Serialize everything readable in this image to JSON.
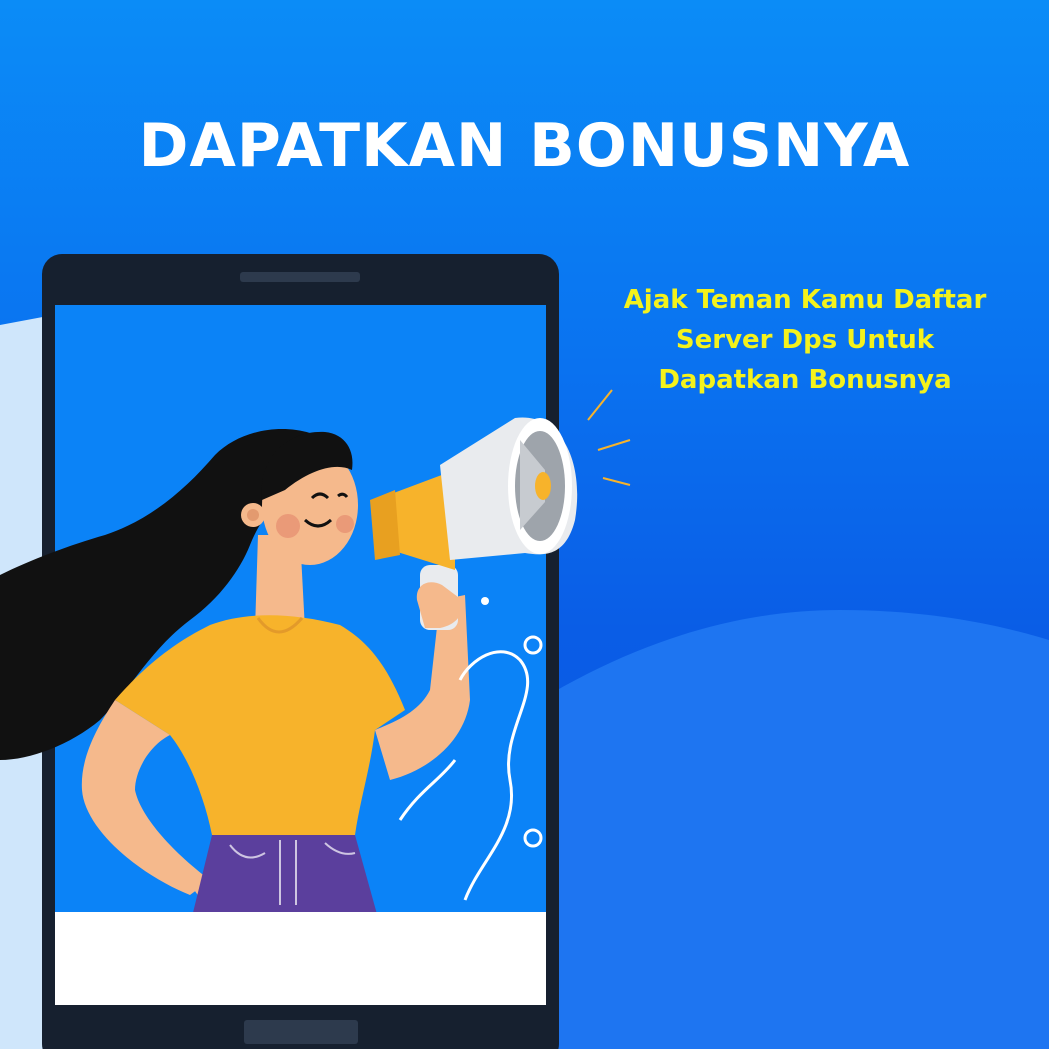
{
  "headline": "DAPATKAN BONUSNYA",
  "tagline": {
    "line1": "Ajak Teman Kamu Daftar",
    "line2": "Server Dps Untuk",
    "line3": "Dapatkan Bonusnya"
  },
  "colors": {
    "background_top": "#0b8cf7",
    "background_bottom": "#0a55e0",
    "wave": "#1e75f1",
    "headline": "#ffffff",
    "tagline": "#f4f21c",
    "phone_frame": "#16202f",
    "phone_screen": "#0b83f7",
    "shirt": "#f7b32b",
    "pants": "#5b3f9d",
    "skin": "#f5b98c",
    "hair": "#111111",
    "megaphone_body": "#e9ebee",
    "megaphone_accent": "#f7b32b"
  },
  "icons": {
    "megaphone": "megaphone-icon",
    "smartphone": "smartphone-icon"
  }
}
